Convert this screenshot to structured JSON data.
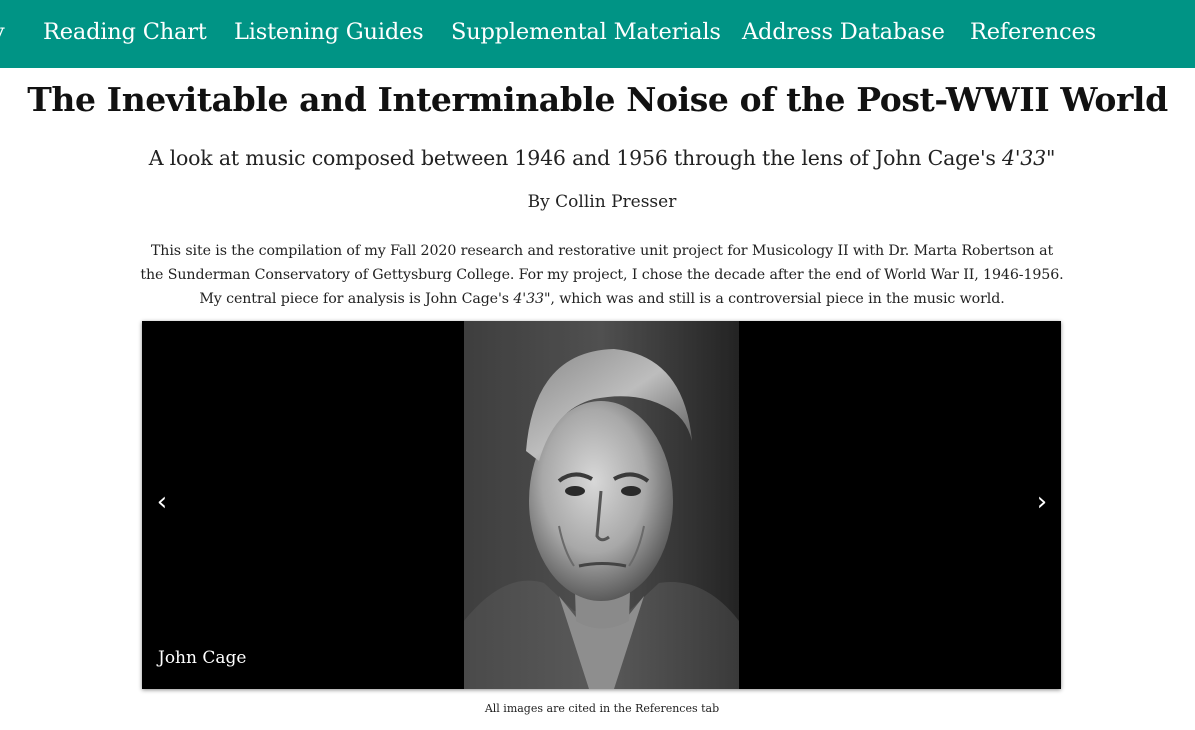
{
  "nav": {
    "items": [
      {
        "label": "y"
      },
      {
        "label": "Reading Chart"
      },
      {
        "label": "Listening Guides"
      },
      {
        "label": "Supplemental Materials"
      },
      {
        "label": "Address Database"
      },
      {
        "label": "References"
      }
    ],
    "background": "#009485"
  },
  "header": {
    "title": "The Inevitable and Interminable Noise of the Post-WWII World",
    "subtitle_prefix": "A look at music composed between 1946 and 1956 through the lens of John Cage's ",
    "subtitle_piece": "4'33\"",
    "byline": "By Collin Presser"
  },
  "intro": {
    "line1": "This site is the compilation of my Fall 2020 research and restorative unit project for Musicology II with Dr. Marta Robertson at",
    "line2": "the Sunderman Conservatory of Gettysburg College. For my project, I chose the decade after the end of World War II, 1946-1956.",
    "line3_prefix": "My central piece for analysis is John Cage's ",
    "line3_piece": "4'33\"",
    "line3_suffix": ", which was and still is a controversial piece in the music world."
  },
  "carousel": {
    "prev_icon": "‹",
    "next_icon": "›",
    "caption": "John Cage"
  },
  "footer": {
    "note": "All images are cited in the References tab"
  }
}
